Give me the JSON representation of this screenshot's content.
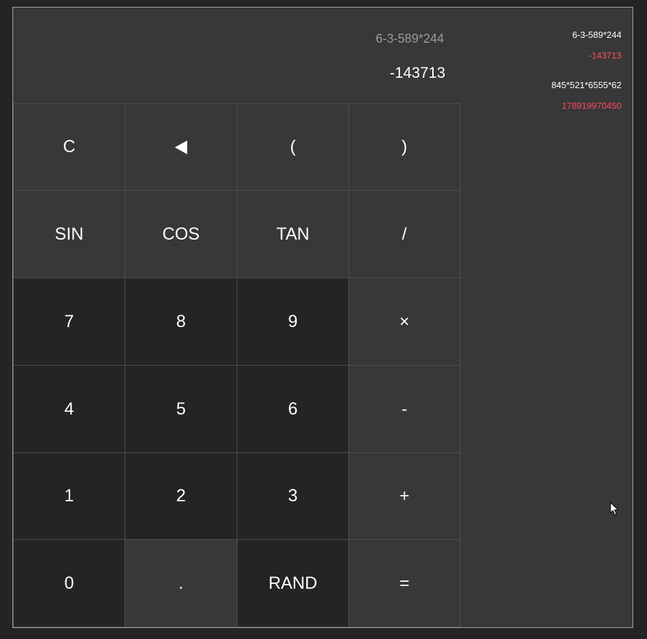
{
  "display": {
    "expression": "6-3-589*244",
    "result": "-143713"
  },
  "keys": {
    "clear": "C",
    "backspace_icon": "backspace-triangle",
    "open_paren": "(",
    "close_paren": ")",
    "sin": "SIN",
    "cos": "COS",
    "tan": "TAN",
    "divide": "/",
    "seven": "7",
    "eight": "8",
    "nine": "9",
    "multiply": "×",
    "four": "4",
    "five": "5",
    "six": "6",
    "minus": "-",
    "one": "1",
    "two": "2",
    "three": "3",
    "plus": "+",
    "zero": "0",
    "dot": ".",
    "rand": "RAND",
    "equals": "="
  },
  "history": [
    {
      "expression": "6-3-589*244",
      "result": "-143713"
    },
    {
      "expression": "845*521*6555*62",
      "result": "178919970450"
    }
  ],
  "colors": {
    "background": "#242424",
    "panel": "#383838",
    "number_key": "#242424",
    "history_result": "#ff4a63",
    "expression_text": "#9a9a9a"
  }
}
